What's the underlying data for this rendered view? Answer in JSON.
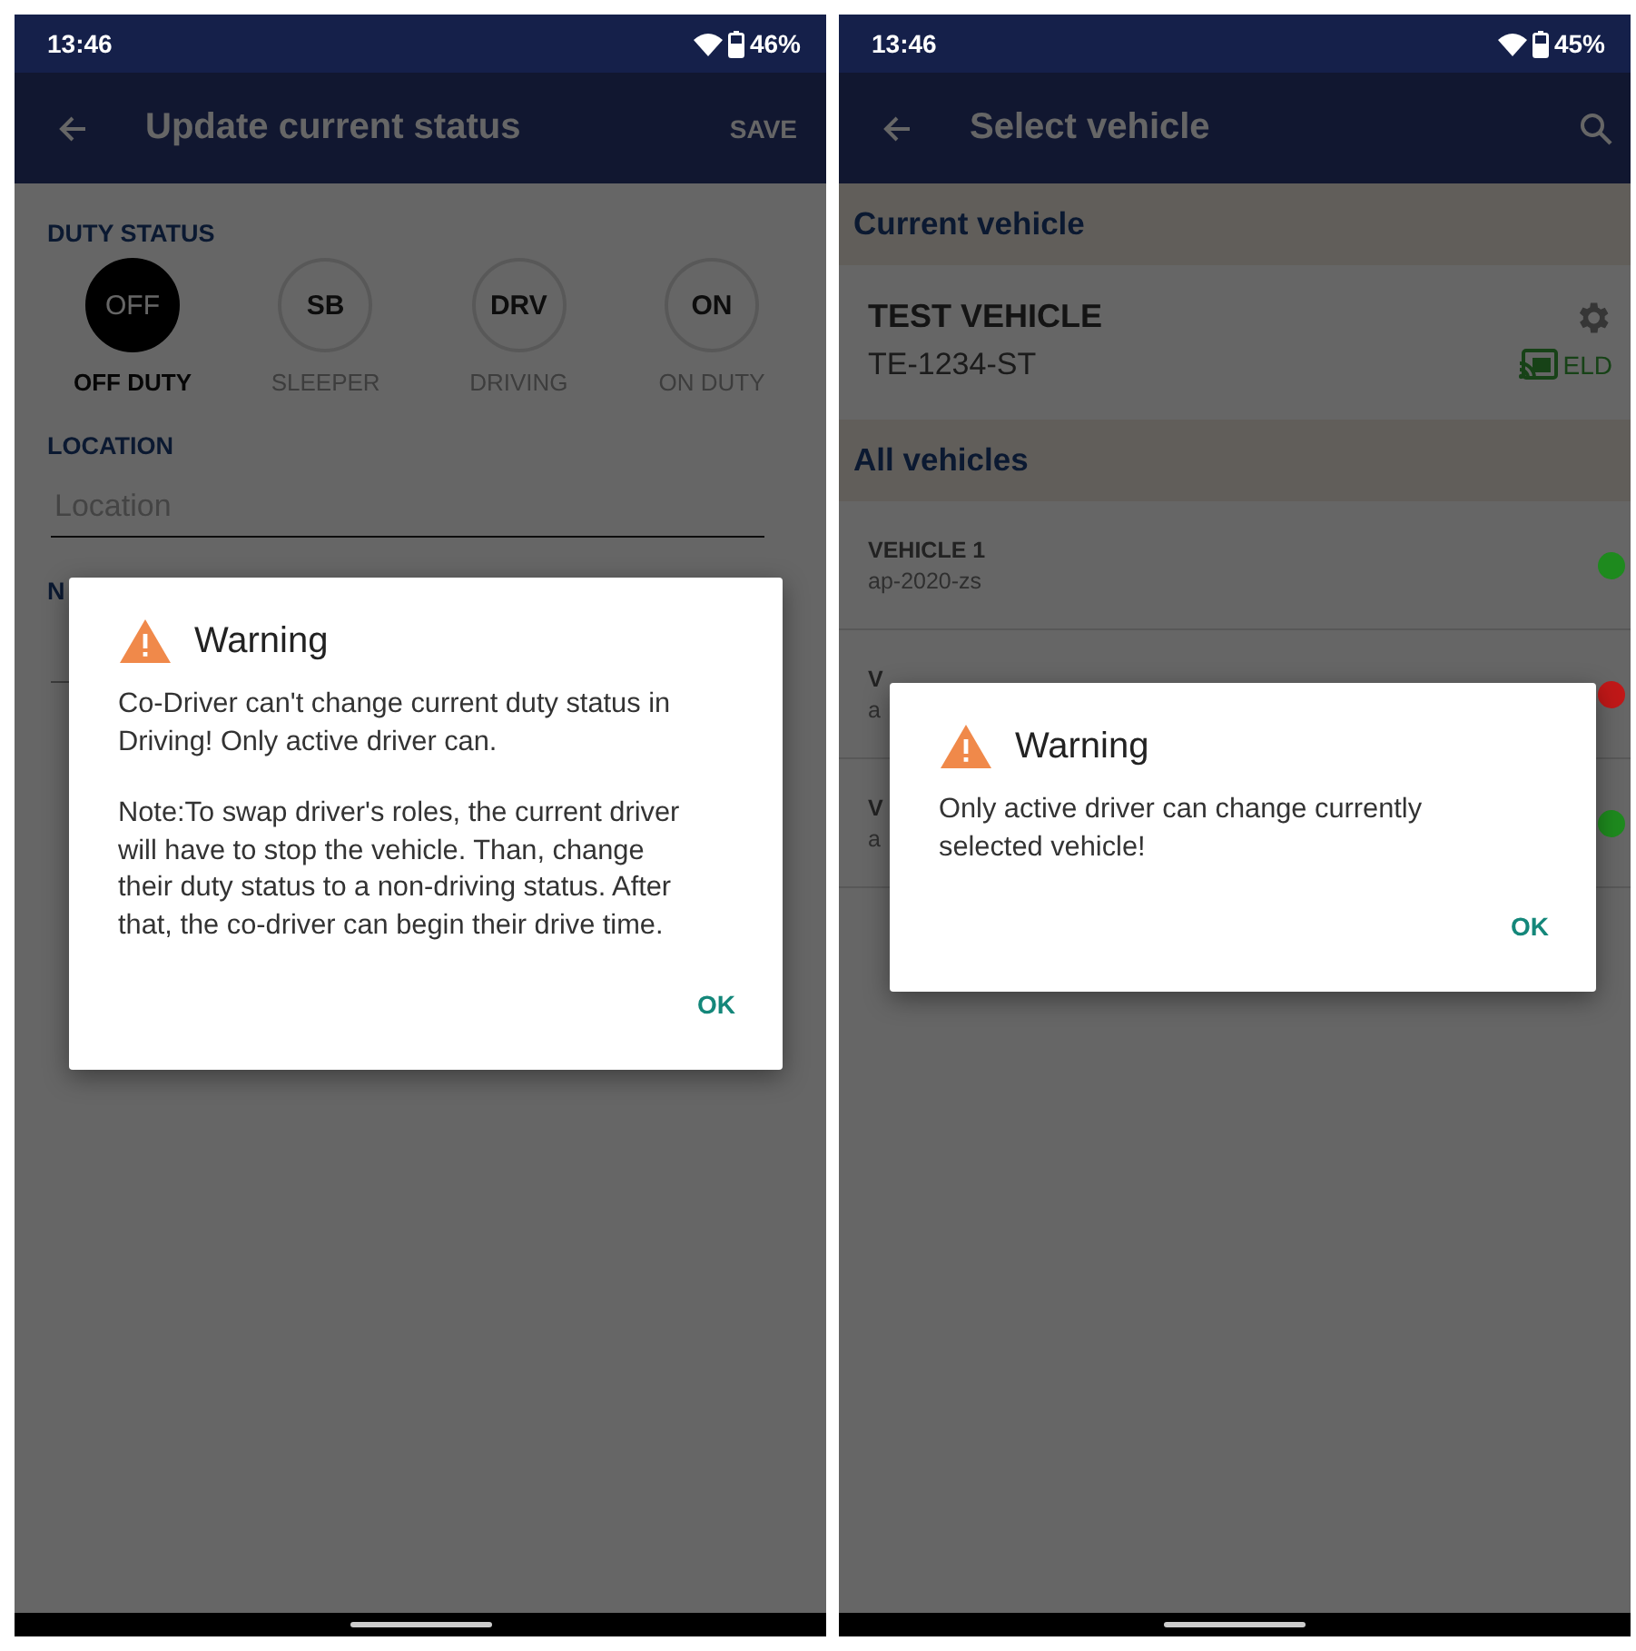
{
  "screens": [
    {
      "kind": "duty",
      "status_bar": {
        "time": "13:46",
        "battery": "46%"
      },
      "app_bar": {
        "title": "Update current status",
        "action": "SAVE"
      },
      "duty_status": {
        "label": "DUTY STATUS",
        "options": [
          {
            "code": "OFF",
            "label": "OFF DUTY",
            "selected": true
          },
          {
            "code": "SB",
            "label": "SLEEPER",
            "selected": false
          },
          {
            "code": "DRV",
            "label": "DRIVING",
            "selected": false
          },
          {
            "code": "ON",
            "label": "ON DUTY",
            "selected": false
          }
        ]
      },
      "location": {
        "label": "LOCATION",
        "placeholder": "Location"
      },
      "notes": {
        "label": "N"
      },
      "dialog": {
        "title": "Warning",
        "paragraphs": [
          "Co-Driver can't change current duty status in Driving! Only active driver can.",
          "Note:To swap driver's roles, the current driver will have to stop the vehicle. Than, change their duty status to a non-driving status. After that, the co-driver can begin their drive time."
        ],
        "button": "OK"
      }
    },
    {
      "kind": "vehicles",
      "status_bar": {
        "time": "13:46",
        "battery": "45%"
      },
      "app_bar": {
        "title": "Select vehicle"
      },
      "current_vehicle": {
        "header": "Current vehicle",
        "name": "TEST VEHICLE",
        "plate": "TE-1234-ST",
        "badge": "ELD"
      },
      "all_vehicles": {
        "header": "All vehicles",
        "items": [
          {
            "name": "VEHICLE 1",
            "plate": "ap-2020-zs",
            "color": "#1e8a1e"
          },
          {
            "name": "V",
            "plate": "a",
            "color": "#c01818"
          },
          {
            "name": "V",
            "plate": "a",
            "color": "#1e8a1e"
          }
        ]
      },
      "dialog": {
        "title": "Warning",
        "paragraphs": [
          "Only active driver can change currently selected vehicle!"
        ],
        "button": "OK"
      }
    }
  ]
}
